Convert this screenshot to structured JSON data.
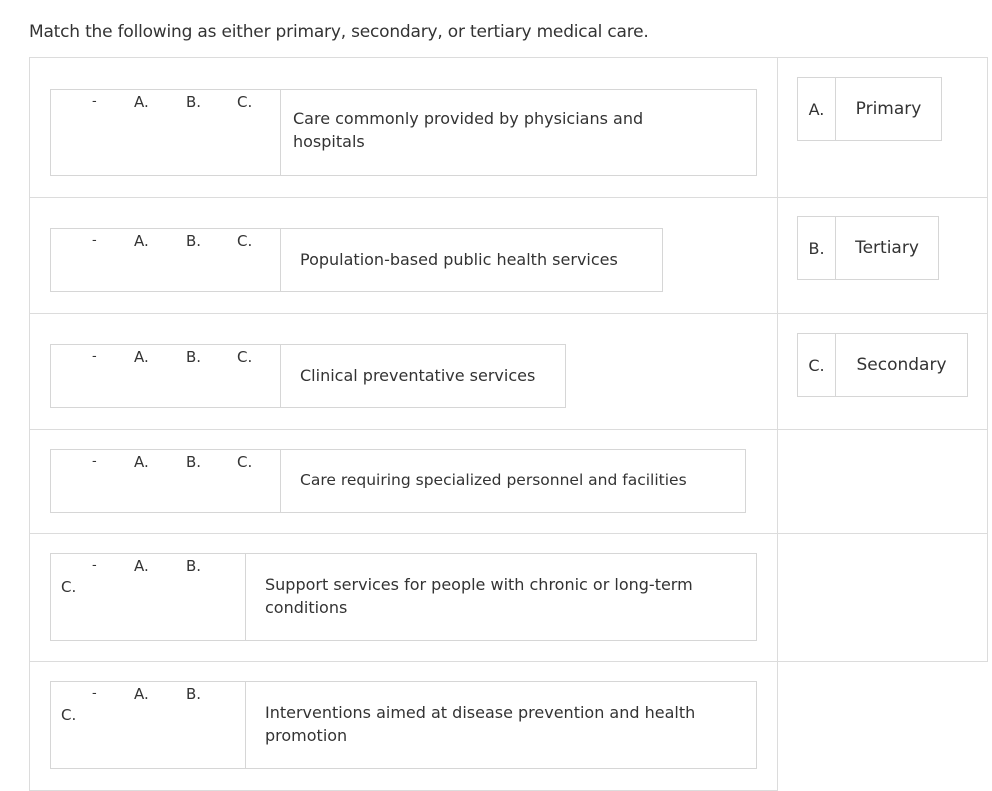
{
  "question": {
    "prompt": "Match the following as either primary, secondary, or tertiary medical care."
  },
  "items": [
    {
      "dash": "-",
      "options": [
        "A.",
        "B.",
        "C."
      ],
      "text": "Care commonly provided by physicians and hospitals",
      "selected": ""
    },
    {
      "dash": "-",
      "options": [
        "A.",
        "B.",
        "C."
      ],
      "text": "Population-based public health services",
      "selected": ""
    },
    {
      "dash": "-",
      "options": [
        "A.",
        "B.",
        "C."
      ],
      "text": "Clinical preventative services",
      "selected": ""
    },
    {
      "dash": "-",
      "options": [
        "A.",
        "B.",
        "C."
      ],
      "text": "Care requiring specialized personnel and facilities",
      "selected": ""
    },
    {
      "dash": "-",
      "options": [
        "A.",
        "B.",
        "C."
      ],
      "text": "Support services for people with chronic or long-term conditions",
      "selected": ""
    },
    {
      "dash": "-",
      "options": [
        "A.",
        "B.",
        "C."
      ],
      "text": "Interventions aimed at disease prevention and health promotion",
      "selected": ""
    }
  ],
  "answers": [
    {
      "letter": "A.",
      "label": "Primary"
    },
    {
      "letter": "B.",
      "label": "Tertiary"
    },
    {
      "letter": "C.",
      "label": "Secondary"
    }
  ]
}
